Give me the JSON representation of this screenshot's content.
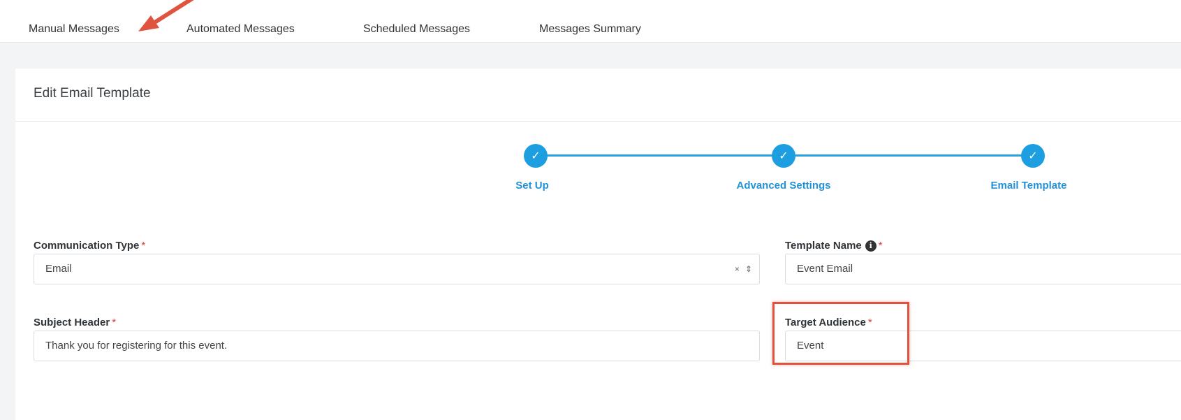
{
  "tabs": [
    {
      "label": "Manual Messages"
    },
    {
      "label": "Automated Messages"
    },
    {
      "label": "Scheduled Messages"
    },
    {
      "label": "Messages Summary"
    }
  ],
  "card": {
    "title": "Edit Email Template"
  },
  "stepper": {
    "steps": [
      {
        "label": "Set Up",
        "check": "✓"
      },
      {
        "label": "Advanced Settings",
        "check": "✓"
      },
      {
        "label": "Email Template",
        "check": "✓"
      }
    ]
  },
  "form": {
    "communication_type": {
      "label": "Communication Type",
      "value": "Email",
      "clear": "×",
      "toggle": "⇕"
    },
    "template_name": {
      "label": "Template Name",
      "value": "Event Email",
      "info": "i"
    },
    "subject_header": {
      "label": "Subject Header",
      "value": "Thank you for registering for this event."
    },
    "target_audience": {
      "label": "Target Audience",
      "value": "Event"
    },
    "required_marker": "*"
  },
  "colors": {
    "accent": "#1d9ee0",
    "annotation": "#e0533f",
    "required": "#e53935"
  },
  "icons": {
    "annotation": "arrow-annotation-icon",
    "info": "info-icon",
    "clear": "clear-icon",
    "sort": "sort-arrows-icon",
    "check": "check-icon"
  }
}
